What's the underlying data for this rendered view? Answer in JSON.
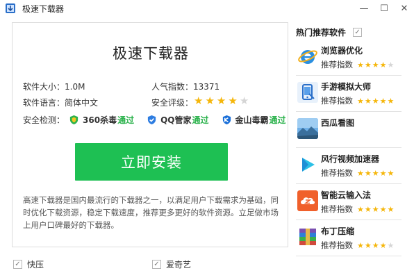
{
  "window": {
    "title": "极速下载器",
    "minimize_glyph": "—",
    "maximize_glyph": "☐",
    "close_glyph": "✕"
  },
  "main": {
    "title": "极速下载器",
    "size_text": "软件大小：1.0M",
    "popularity_text": "人气指数：13371",
    "language_text": "软件语言：简体中文",
    "safety_label": "安全评级：",
    "safety_rating": 4,
    "safety_rating_max": 5,
    "security_label": "安全检测：",
    "security_checks": [
      {
        "name": "360杀毒",
        "status": "通过",
        "icon": "shield-360-icon",
        "color": "#2bb24c"
      },
      {
        "name": "QQ管家",
        "status": "通过",
        "icon": "shield-qq-icon",
        "color": "#2e7de1"
      },
      {
        "name": "金山毒霸",
        "status": "通过",
        "icon": "shield-kingsoft-icon",
        "color": "#1a6fd8"
      }
    ],
    "install_label": "立即安装",
    "description": "高速下载器是国内最流行的下载器之一，以满足用户下载需求为基础，同时优化下载资源，稳定下载速度，推荐更多更好的软件资源。立足做市场上用户口碑最好的下载器。"
  },
  "bundles": [
    {
      "label": "快压",
      "checked": true
    },
    {
      "label": "爱奇艺",
      "checked": true
    }
  ],
  "sidebar": {
    "header": "热门推荐软件",
    "header_checked": true,
    "rec_label": "推荐指数",
    "items": [
      {
        "name": "浏览器优化",
        "icon": "ie-browser-icon",
        "rating": 4
      },
      {
        "name": "手游模拟大师",
        "icon": "phone-emulator-icon",
        "rating": 5
      },
      {
        "name": "西瓜看图",
        "icon": "landscape-photo-icon",
        "rating": null
      },
      {
        "name": "风行视频加速器",
        "icon": "play-triangle-icon",
        "rating": 5
      },
      {
        "name": "智能云输入法",
        "icon": "cloud-input-icon",
        "rating": 5
      },
      {
        "name": "布丁压缩",
        "icon": "archive-box-icon",
        "rating": 4
      }
    ]
  },
  "colors": {
    "accent_green": "#1ec053",
    "star_gold": "#f5b60a",
    "star_gray": "#d5d5d5",
    "pass_green": "#2bb24c"
  }
}
